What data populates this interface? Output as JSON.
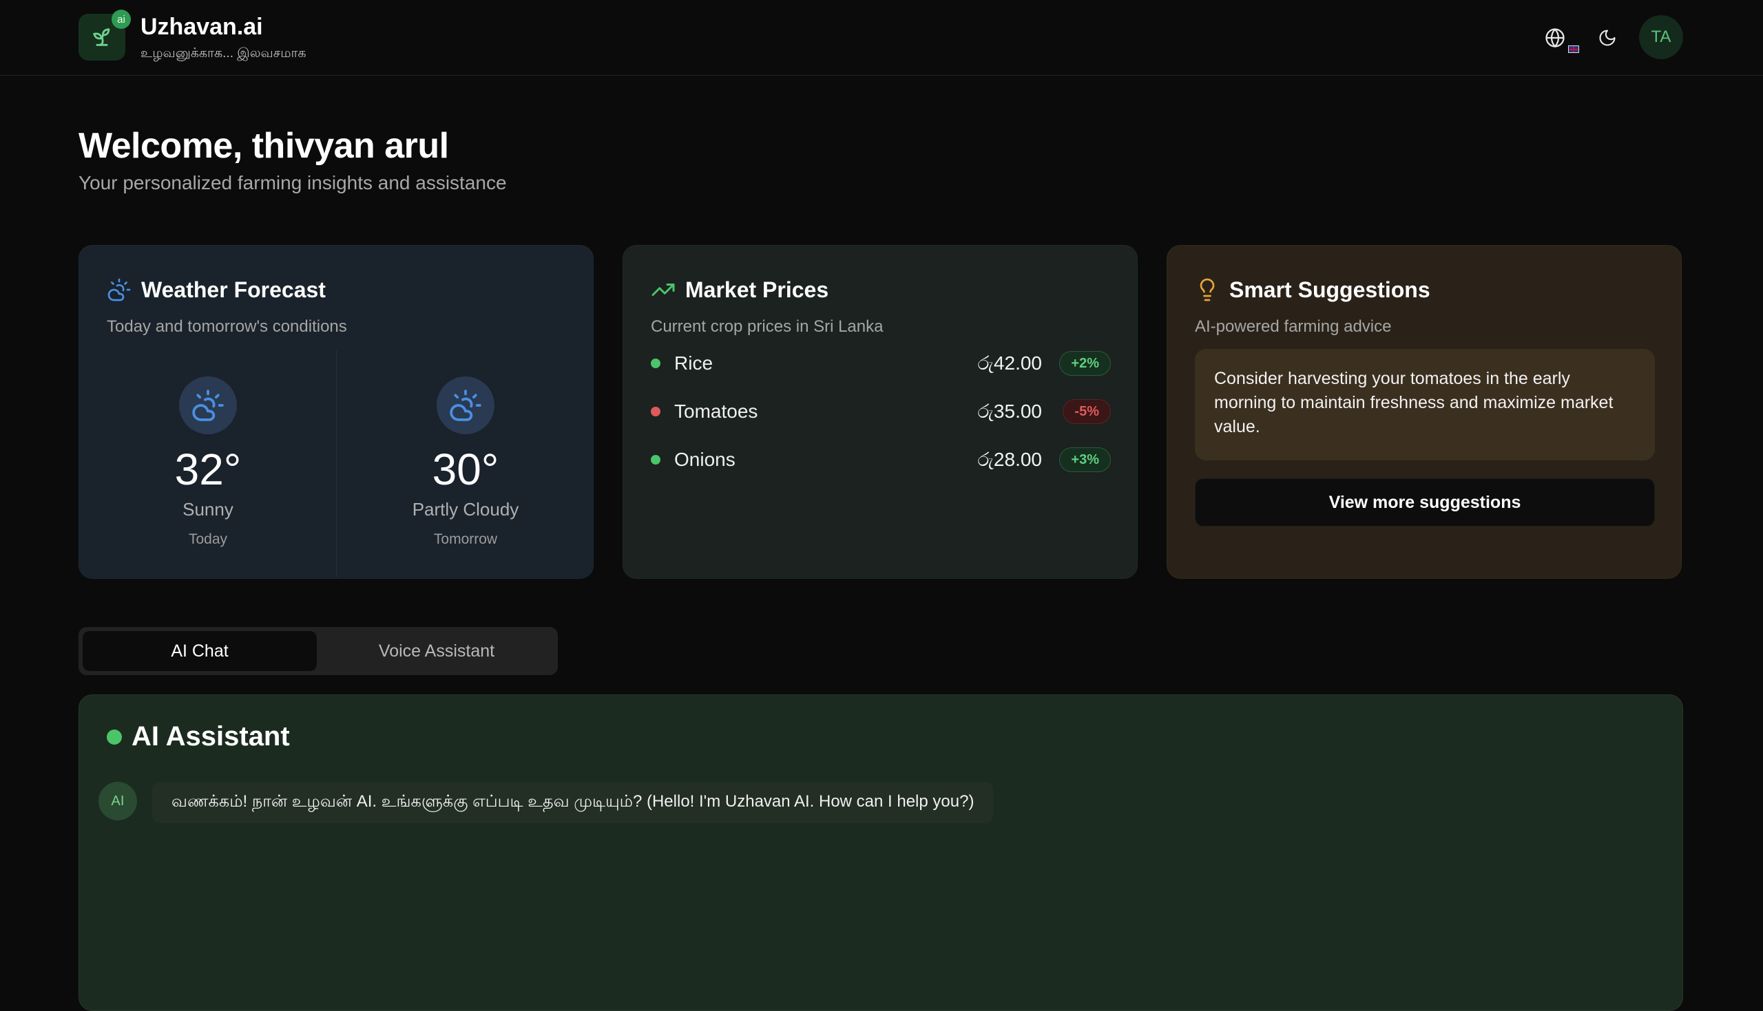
{
  "brand": {
    "badge": "ai",
    "title": "Uzhavan.ai",
    "subtitle": "உழவனுக்காக... இலவசமாக"
  },
  "header": {
    "avatar_initials": "TA",
    "icons": [
      "globe-icon",
      "uk-flag-icon",
      "moon-icon"
    ]
  },
  "welcome": {
    "title": "Welcome, thivyan arul",
    "subtitle": "Your personalized farming insights and assistance"
  },
  "weather": {
    "title": "Weather Forecast",
    "subtitle": "Today and tomorrow's conditions",
    "days": [
      {
        "temp": "32°",
        "condition": "Sunny",
        "day": "Today"
      },
      {
        "temp": "30°",
        "condition": "Partly Cloudy",
        "day": "Tomorrow"
      }
    ]
  },
  "market": {
    "title": "Market Prices",
    "subtitle": "Current crop prices in Sri Lanka",
    "items": [
      {
        "name": "Rice",
        "price": "රු42.00",
        "change": "+2%",
        "trend": "up"
      },
      {
        "name": "Tomatoes",
        "price": "රු35.00",
        "change": "-5%",
        "trend": "down"
      },
      {
        "name": "Onions",
        "price": "රු28.00",
        "change": "+3%",
        "trend": "up"
      }
    ]
  },
  "suggestions": {
    "title": "Smart Suggestions",
    "subtitle": "AI-powered farming advice",
    "text": "Consider harvesting your tomatoes in the early morning to maintain freshness and maximize market value.",
    "button": "View more suggestions"
  },
  "tabs": {
    "active": "AI Chat",
    "inactive": "Voice Assistant"
  },
  "chat": {
    "title": "AI Assistant",
    "avatar": "AI",
    "message": "வணக்கம்! நான் உழவன் AI. உங்களுக்கு எப்படி உதவ முடியும்? (Hello! I'm Uzhavan AI. How can I help you?)"
  },
  "colors": {
    "accent_green": "#4cc46a",
    "down_red": "#e05a5a",
    "weather_blue": "#4a90e2",
    "suggest_amber": "#e8a33a"
  }
}
